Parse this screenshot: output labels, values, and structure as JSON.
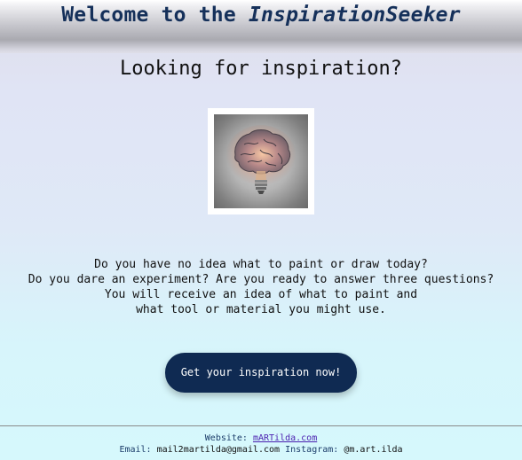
{
  "header": {
    "title_prefix": "Welcome to the ",
    "title_brand": "InspirationSeeker"
  },
  "hero": {
    "subtitle": "Looking for inspiration?",
    "image_icon": "brain-lightbulb-icon"
  },
  "intro": {
    "lines": [
      "Do you have no idea what to paint or draw today?",
      "Do you dare an experiment? Are you ready to answer three questions?",
      "You will receive an idea of what to paint and",
      "what tool or material you might use."
    ]
  },
  "cta": {
    "label": "Get your inspiration now!"
  },
  "footer": {
    "website_label": "Website: ",
    "website_link": "mARTilda.com",
    "email_label": "Email: ",
    "email_value": "mail2martilda@gmail.com",
    "instagram_label": " Instagram: ",
    "instagram_value": "@m.art.ilda"
  },
  "colors": {
    "header_text": "#15305a",
    "cta_background": "#0f2a52",
    "link": "#4a1fb0"
  }
}
